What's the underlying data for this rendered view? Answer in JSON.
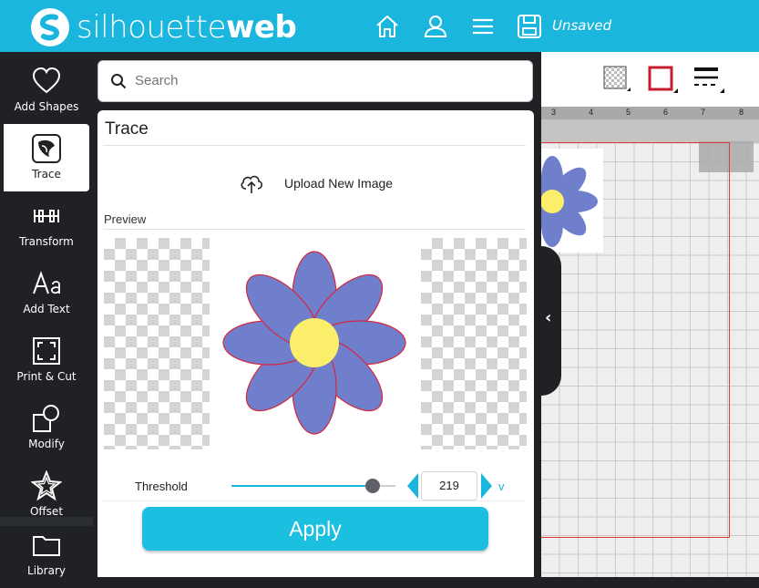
{
  "header": {
    "brand_light": "silhouette",
    "brand_bold": "web",
    "status": "Unsaved",
    "icons": [
      "home-icon",
      "user-icon",
      "menu-icon",
      "save-icon"
    ]
  },
  "rail": {
    "items": [
      {
        "label": "Add Shapes",
        "icon": "heart-icon"
      },
      {
        "label": "Trace",
        "icon": "trace-icon",
        "active": true
      },
      {
        "label": "Transform",
        "icon": "transform-icon"
      },
      {
        "label": "Add Text",
        "icon": "text-icon"
      },
      {
        "label": "Print & Cut",
        "icon": "print-cut-icon"
      },
      {
        "label": "Modify",
        "icon": "modify-icon"
      },
      {
        "label": "Offset",
        "icon": "star-icon"
      },
      {
        "label": "Library",
        "icon": "folder-icon"
      }
    ]
  },
  "search": {
    "placeholder": "Search"
  },
  "trace": {
    "title": "Trace",
    "upload_label": "Upload New Image",
    "preview_label": "Preview",
    "threshold_label": "Threshold",
    "threshold_value": "219",
    "threshold_fraction": 0.86,
    "unit": "v",
    "apply_label": "Apply"
  },
  "canvas": {
    "ruler_ticks": [
      "3",
      "4",
      "5",
      "6",
      "7",
      "8"
    ],
    "colors": {
      "flower": "#6f7fcc",
      "center": "#fbee6a",
      "outline": "#d7263d",
      "accent": "#1bb6dd"
    }
  }
}
